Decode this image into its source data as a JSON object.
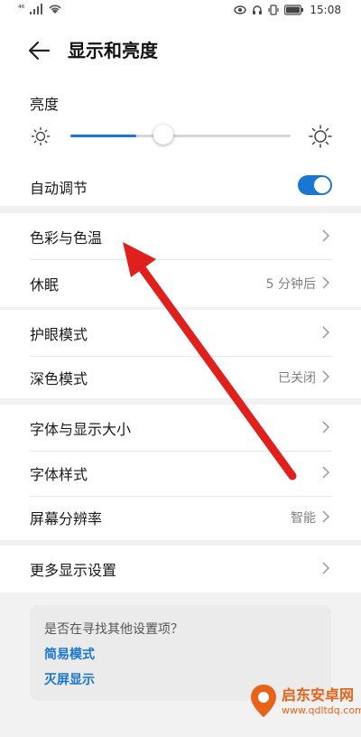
{
  "status_bar": {
    "signal_label": "⁴⁶",
    "time": "15:08",
    "icons": [
      "signal-icon",
      "wifi-icon",
      "eye-icon",
      "headset-icon",
      "vibrate-icon",
      "battery-icon"
    ]
  },
  "header": {
    "title": "显示和亮度",
    "back_icon": "back-arrow-icon"
  },
  "brightness": {
    "label": "亮度",
    "level_fraction": 0.3,
    "auto_label": "自动调节",
    "auto_enabled": true
  },
  "section1": [
    {
      "label": "色彩与色温",
      "value": ""
    },
    {
      "label": "休眠",
      "value": "5 分钟后"
    }
  ],
  "section2": [
    {
      "label": "护眼模式",
      "value": ""
    },
    {
      "label": "深色模式",
      "value": "已关闭"
    }
  ],
  "section3": [
    {
      "label": "字体与显示大小",
      "value": ""
    },
    {
      "label": "字体样式",
      "value": ""
    },
    {
      "label": "屏幕分辨率",
      "value": "智能"
    }
  ],
  "section4": [
    {
      "label": "更多显示设置",
      "value": ""
    }
  ],
  "tip": {
    "title": "是否在寻找其他设置项？",
    "links": [
      "简易模式",
      "灭屏显示"
    ]
  },
  "watermark": {
    "name": "启东安卓网",
    "url": "www.qdltdq.com"
  },
  "colors": {
    "accent": "#1976d2",
    "annotation_arrow": "#e0201c",
    "watermark": "#e8631a"
  }
}
